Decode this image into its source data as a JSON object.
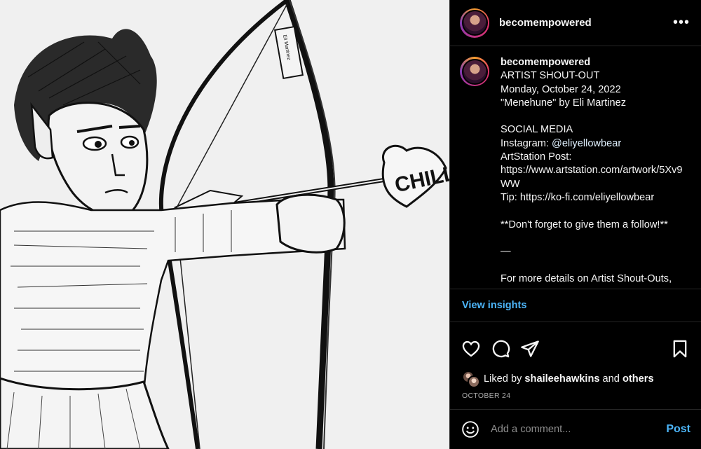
{
  "post": {
    "username": "becomempowered",
    "more_icon": "more-horizontal-icon",
    "image_lettering": {
      "arrow_text": "CHILL",
      "bow_text": "Eli Martinez"
    }
  },
  "caption": {
    "username": "becomempowered",
    "lines": [
      "ARTIST SHOUT-OUT",
      "Monday, October 24, 2022",
      "\"Menehune\" by Eli Martinez",
      "",
      "SOCIAL MEDIA"
    ],
    "instagram_label": "Instagram: ",
    "instagram_handle": "@eliyellowbear",
    "lines_after": [
      "ArtStation Post:",
      "https://www.artstation.com/artwork/5Xv9WW",
      "Tip: https://ko-fi.com/eliyellowbear",
      "",
      "**Don't forget to give them a follow!**",
      "",
      "—",
      "",
      "For more details on Artist Shout-Outs,"
    ]
  },
  "insights": {
    "label": "View insights"
  },
  "actions": {
    "icons": [
      "heart-icon",
      "comment-icon",
      "share-icon",
      "bookmark-icon"
    ]
  },
  "likes": {
    "prefix": "Liked by ",
    "user": "shaileehawkins",
    "middle": " and ",
    "others": "others"
  },
  "date": "OCTOBER 24",
  "comment_box": {
    "placeholder": "Add a comment...",
    "post_label": "Post",
    "emoji_icon": "emoji-icon"
  },
  "colors": {
    "background": "#000000",
    "link_blue": "#4cb5f9",
    "divider": "#262626",
    "muted": "#a8a8a8"
  }
}
